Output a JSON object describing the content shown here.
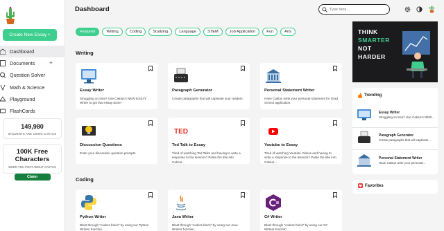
{
  "sidebar": {
    "create_label": "Create New Essay +",
    "nav": [
      {
        "label": "Dashboard",
        "icon": "home-icon"
      },
      {
        "label": "Documents",
        "icon": "document-icon"
      },
      {
        "label": "Question Solver",
        "icon": "question-icon"
      },
      {
        "label": "Math & Science",
        "icon": "math-icon"
      },
      {
        "label": "Playground",
        "icon": "playground-icon"
      },
      {
        "label": "FlashCards",
        "icon": "flashcards-icon"
      }
    ],
    "documents_add": "+",
    "stats": {
      "students_count": "149,980",
      "students_label": "STUDENTS ARE USING CAKTUS"
    },
    "promo": {
      "title": "100K Free Characters",
      "subtitle": "WHEN YOU POST ABOUT CAKTUS",
      "button": "Claim"
    }
  },
  "header": {
    "title": "Dashboard",
    "search_placeholder": "Type here..."
  },
  "chips": [
    "Featured",
    "Writing",
    "Coding",
    "Studying",
    "Language",
    "STEM",
    "Job Application",
    "Fun",
    "Arts"
  ],
  "sections": {
    "writing": "Writing",
    "coding": "Coding"
  },
  "writing_cards": [
    {
      "title": "Essay Writer",
      "desc": "Struggling on time? Use Caktus's NEW ESSAY Writer to get that essay done!",
      "icon": "monitor-icon"
    },
    {
      "title": "Paragraph Generator",
      "desc": "Create paragraphs that will captivate your readers.",
      "icon": "typewriter-icon"
    },
    {
      "title": "Personal Statement Writer",
      "desc": "Have Caktus write your personal statement for Grad School application.",
      "icon": "university-icon"
    },
    {
      "title": "Discussion Questions",
      "desc": "Enter your discussion question prompts.",
      "icon": "lightbulb-icon"
    },
    {
      "title": "Ted Talk to Essay",
      "desc": "Tired of watching Ted Talks and having to write a response to the lessons? Paste the title into Caktus...",
      "icon": "ted-icon"
    },
    {
      "title": "Youtube to Essay",
      "desc": "Tired of watching Youtube Videos and having to write a response to the lessons? Paste the title into Caktus...",
      "icon": "youtube-icon"
    }
  ],
  "ted_logo": "TED",
  "coding_cards": [
    {
      "title": "Python Writer",
      "desc": "Blast through \"coders block\" by using our Python Writers function.",
      "icon": "python-icon"
    },
    {
      "title": "Java Writer",
      "desc": "Blast through \"coders block\" by using our Java Writers function.",
      "icon": "java-icon"
    },
    {
      "title": "C# Writer",
      "desc": "Blast through \"coders block\" by using our C# Writers function.",
      "icon": "csharp-icon"
    }
  ],
  "promo_banner": [
    "THINK",
    "SMARTER",
    "NOT",
    "HARDER"
  ],
  "trending": {
    "title": "Trending",
    "items": [
      {
        "title": "Essay Writer",
        "desc": "Struggling on time? Use Caktus's NEW..."
      },
      {
        "title": "Paragraph Generator",
        "desc": "Create paragraphs that will captivate..."
      },
      {
        "title": "Personal Statement Writer",
        "desc": "Have Caktus write your personal..."
      }
    ]
  },
  "favorites": {
    "title": "Favorites"
  },
  "colors": {
    "accent": "#3ecf8e",
    "claim": "#15803d",
    "promo_bg": "#1b1b1d",
    "smarter": "#3ecf8e"
  }
}
